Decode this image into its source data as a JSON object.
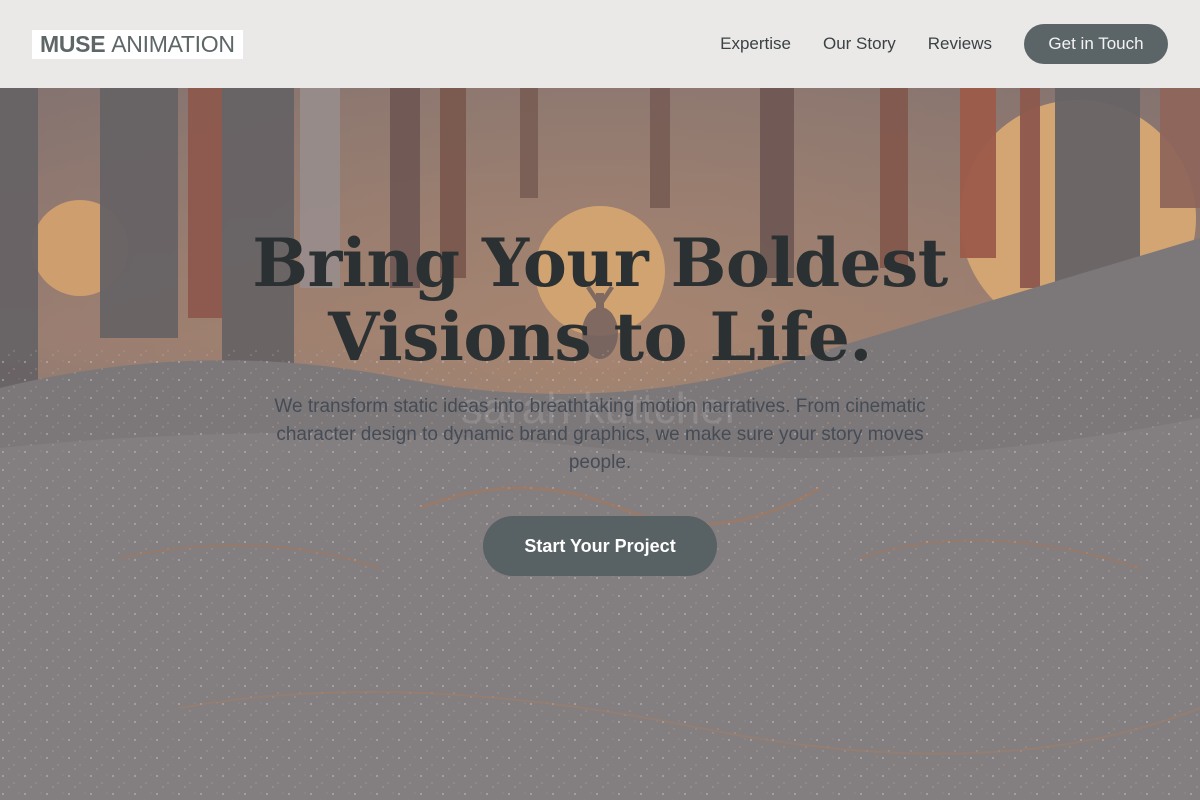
{
  "header": {
    "logo": {
      "strong": "MUSE",
      "light": "ANIMATION"
    },
    "nav": [
      {
        "label": "Expertise"
      },
      {
        "label": "Our Story"
      },
      {
        "label": "Reviews"
      }
    ],
    "cta_label": "Get in Touch"
  },
  "hero": {
    "title_line1": "Bring Your Boldest",
    "title_line2": "Visions to Life.",
    "subtitle": "We transform static ideas into breathtaking motion narratives. From cinematic character design to dynamic brand graphics, we make sure your story moves people.",
    "cta_label": "Start Your Project",
    "background_image": "forest-sunset-deer",
    "watermark_text": "sarah kuttcher"
  },
  "colors": {
    "header_bg": "#ebe9e8",
    "button_bg": "#5b6567",
    "title_text": "#2b3132",
    "sun": "#f7b35e"
  }
}
